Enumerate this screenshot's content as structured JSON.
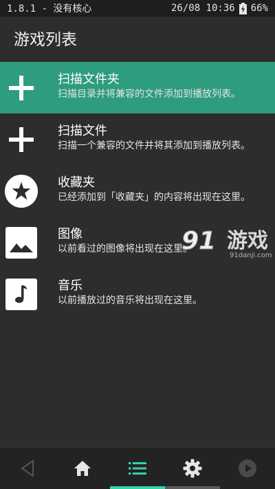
{
  "status_bar": {
    "left_text": "1.8.1 - 没有核心",
    "datetime": "26/08 10:36",
    "battery": "66%"
  },
  "header": {
    "title": "游戏列表"
  },
  "menu": [
    {
      "title": "扫描文件夹",
      "subtitle": "扫描目录并将兼容的文件添加到播放列表。",
      "icon": "plus-icon",
      "active": true
    },
    {
      "title": "扫描文件",
      "subtitle": "扫描一个兼容的文件并将其添加到播放列表。",
      "icon": "plus-icon",
      "active": false
    },
    {
      "title": "收藏夹",
      "subtitle": "已经添加到「收藏夹」的内容将出现在这里。",
      "icon": "star-icon",
      "active": false
    },
    {
      "title": "图像",
      "subtitle": "以前看过的图像将出现在这里。",
      "icon": "image-icon",
      "active": false
    },
    {
      "title": "音乐",
      "subtitle": "以前播放过的音乐将出现在这里。",
      "icon": "music-note-icon",
      "active": false
    }
  ],
  "watermark": {
    "text": "游戏",
    "url": "91danji.com",
    "logo": "91"
  },
  "bottom_nav": [
    "back-icon",
    "home-icon",
    "list-icon",
    "gear-icon",
    "play-icon"
  ],
  "colors": {
    "accent": "#2e9c7e",
    "indicator": "#35d1ad",
    "background": "#2d2d2d"
  }
}
